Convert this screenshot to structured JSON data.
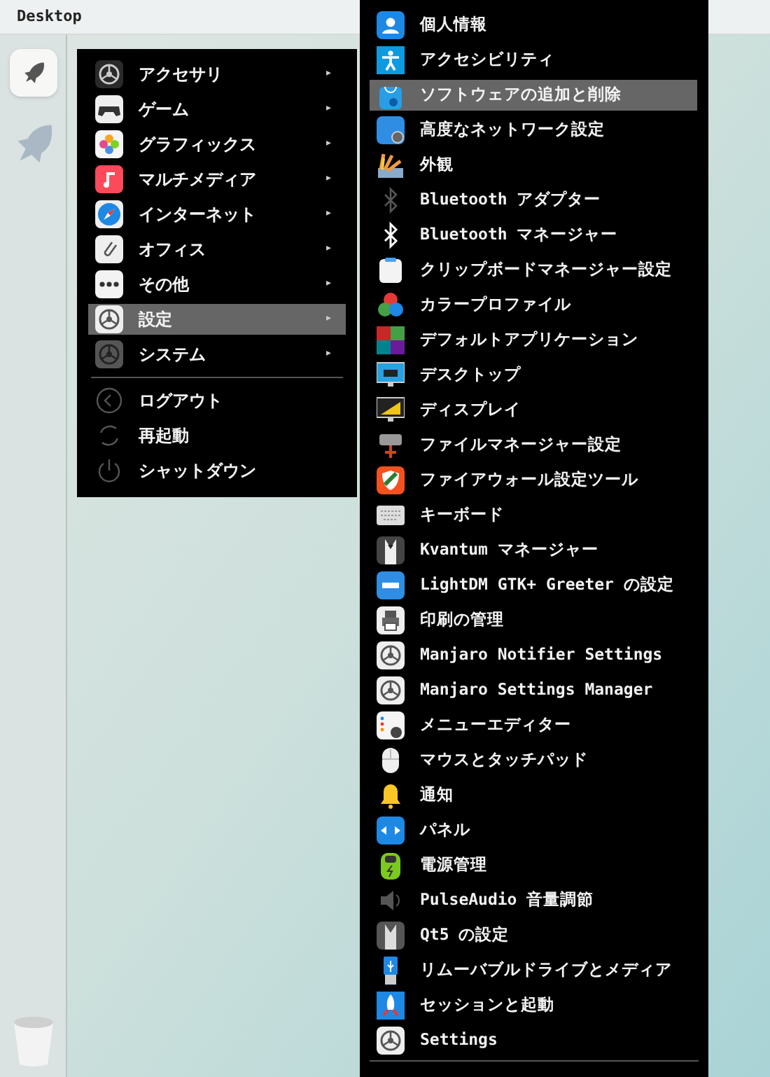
{
  "top_bar": {
    "title": "Desktop"
  },
  "menu": {
    "items": [
      {
        "label": "アクセサリ",
        "arrow": "▸",
        "selected": false
      },
      {
        "label": "ゲーム",
        "arrow": "▸",
        "selected": false
      },
      {
        "label": "グラフィックス",
        "arrow": "▸",
        "selected": false
      },
      {
        "label": "マルチメディア",
        "arrow": "▸",
        "selected": false
      },
      {
        "label": "インターネット",
        "arrow": "▸",
        "selected": false
      },
      {
        "label": "オフィス",
        "arrow": "▸",
        "selected": false
      },
      {
        "label": "その他",
        "arrow": "▸",
        "selected": false
      },
      {
        "label": "設定",
        "arrow": "▸",
        "selected": true
      },
      {
        "label": "システム",
        "arrow": "▸",
        "selected": false
      }
    ],
    "session_items": [
      {
        "label": "ログアウト"
      },
      {
        "label": "再起動"
      },
      {
        "label": "シャットダウン"
      }
    ]
  },
  "submenu": {
    "items": [
      {
        "label": "個人情報",
        "selected": false
      },
      {
        "label": "アクセシビリティ",
        "selected": false
      },
      {
        "label": "ソフトウェアの追加と削除",
        "selected": true
      },
      {
        "label": "高度なネットワーク設定",
        "selected": false
      },
      {
        "label": "外観",
        "selected": false
      },
      {
        "label": "Bluetooth アダプター",
        "selected": false
      },
      {
        "label": "Bluetooth マネージャー",
        "selected": false
      },
      {
        "label": "クリップボードマネージャー設定",
        "selected": false
      },
      {
        "label": "カラープロファイル",
        "selected": false
      },
      {
        "label": "デフォルトアプリケーション",
        "selected": false
      },
      {
        "label": "デスクトップ",
        "selected": false
      },
      {
        "label": "ディスプレイ",
        "selected": false
      },
      {
        "label": "ファイルマネージャー設定",
        "selected": false
      },
      {
        "label": "ファイアウォール設定ツール",
        "selected": false
      },
      {
        "label": "キーボード",
        "selected": false
      },
      {
        "label": "Kvantum マネージャー",
        "selected": false
      },
      {
        "label": "LightDM GTK+ Greeter の設定",
        "selected": false
      },
      {
        "label": "印刷の管理",
        "selected": false
      },
      {
        "label": "Manjaro Notifier Settings",
        "selected": false
      },
      {
        "label": "Manjaro Settings Manager",
        "selected": false
      },
      {
        "label": "メニューエディター",
        "selected": false
      },
      {
        "label": "マウスとタッチパッド",
        "selected": false
      },
      {
        "label": "通知",
        "selected": false
      },
      {
        "label": "パネル",
        "selected": false
      },
      {
        "label": "電源管理",
        "selected": false
      },
      {
        "label": "PulseAudio 音量調節",
        "selected": false
      },
      {
        "label": "Qt5 の設定",
        "selected": false
      },
      {
        "label": "リムーバブルドライブとメディア",
        "selected": false
      },
      {
        "label": "セッションと起動",
        "selected": false
      },
      {
        "label": "Settings",
        "selected": false
      }
    ]
  }
}
